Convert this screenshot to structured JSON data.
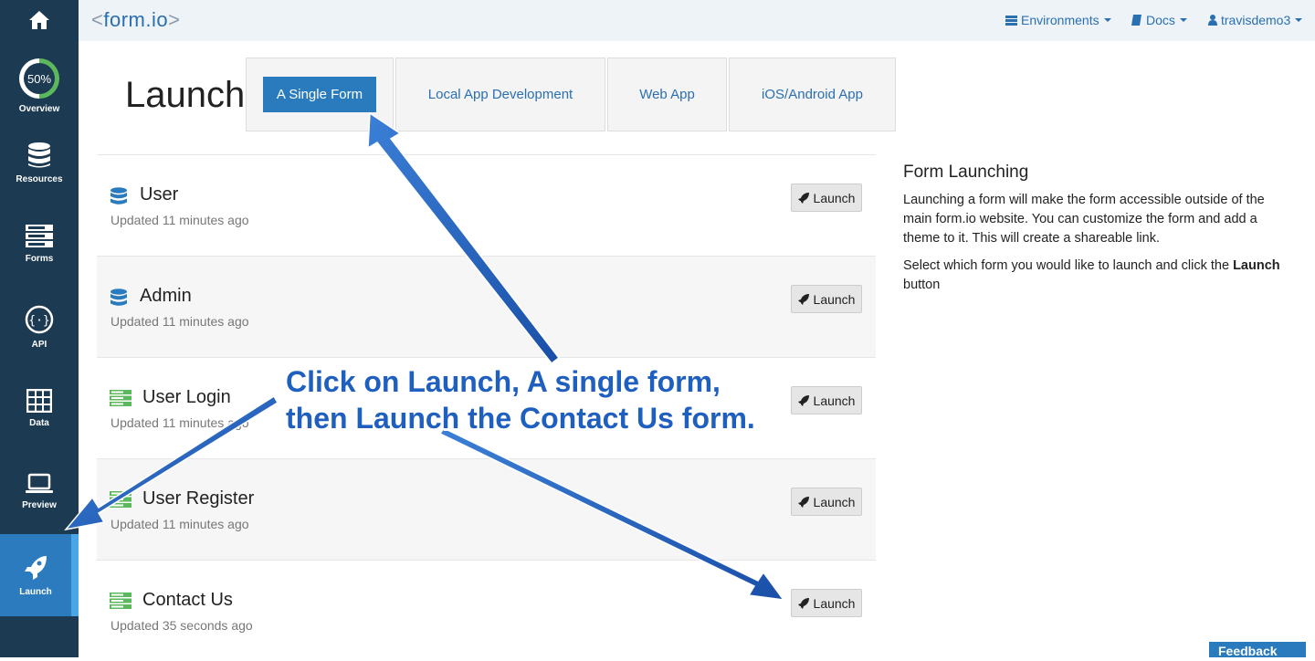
{
  "sidebar": {
    "overview_percent": "50%",
    "items": [
      {
        "label": "Overview",
        "icon": "progress-ring-icon"
      },
      {
        "label": "Resources",
        "icon": "database-icon"
      },
      {
        "label": "Forms",
        "icon": "forms-icon"
      },
      {
        "label": "API",
        "icon": "api-icon"
      },
      {
        "label": "Data",
        "icon": "grid-icon"
      },
      {
        "label": "Preview",
        "icon": "laptop-icon"
      },
      {
        "label": "Launch",
        "icon": "rocket-icon",
        "active": true
      }
    ]
  },
  "topnav": {
    "logo_left": "<",
    "logo_text": "form.io",
    "logo_right": ">",
    "environments": "Environments",
    "docs": "Docs",
    "user": "travisdemo3"
  },
  "page": {
    "title": "Launch",
    "tabs": [
      "A Single Form",
      "Local App Development",
      "Web App",
      "iOS/Android App"
    ]
  },
  "forms": [
    {
      "name": "User",
      "updated": "Updated 11 minutes ago",
      "icon": "database-icon",
      "button": "Launch"
    },
    {
      "name": "Admin",
      "updated": "Updated 11 minutes ago",
      "icon": "database-icon",
      "button": "Launch"
    },
    {
      "name": "User Login",
      "updated": "Updated 11 minutes ago",
      "icon": "form-icon",
      "button": "Launch"
    },
    {
      "name": "User Register",
      "updated": "Updated 11 minutes ago",
      "icon": "form-icon",
      "button": "Launch"
    },
    {
      "name": "Contact Us",
      "updated": "Updated 35 seconds ago",
      "icon": "form-icon",
      "button": "Launch"
    }
  ],
  "info": {
    "heading": "Form Launching",
    "para1": "Launching a form will make the form accessible outside of the main form.io website. You can customize the form and add a theme to it. This will create a shareable link.",
    "para2_prefix": "Select which form you would like to launch and click the",
    "para2_bold": "Launch",
    "para2_suffix": "button"
  },
  "annotation": {
    "line1": "Click on Launch, A single form,",
    "line2": "then Launch the Contact Us form."
  },
  "feedback": "Feedback",
  "colors": {
    "sidebar": "#1c3a52",
    "accent": "#2a7bbd",
    "annotation": "#1f5fbf",
    "resource_icon": "#2a7bbd",
    "form_icon": "#5cb85c"
  }
}
